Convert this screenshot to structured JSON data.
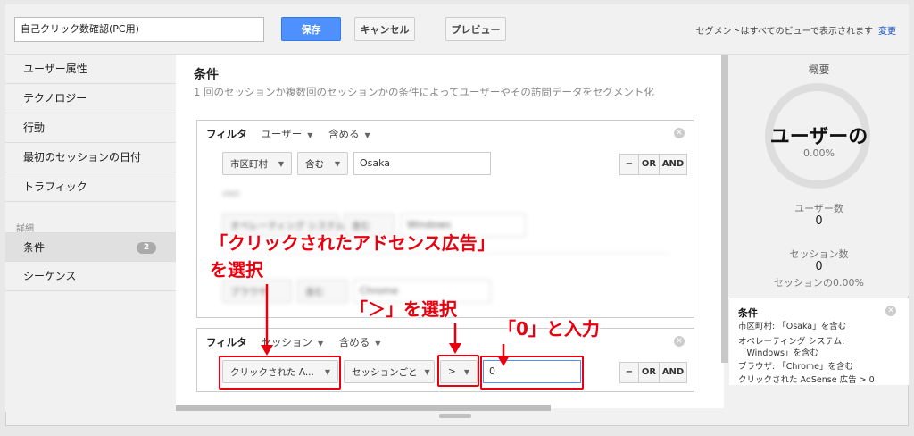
{
  "topbar": {
    "segment_name": "自己クリック数確認(PC用)",
    "save_label": "保存",
    "cancel_label": "キャンセル",
    "preview_label": "プレビュー",
    "segment_note": "セグメントはすべてのビューで表示されます",
    "change_link": "変更"
  },
  "sidebar": {
    "items": [
      "ユーザー属性",
      "テクノロジー",
      "行動",
      "最初のセッションの日付",
      "トラフィック"
    ],
    "section_label": "詳細",
    "advanced_items": [
      {
        "label": "条件",
        "badge": "2"
      },
      {
        "label": "シーケンス"
      }
    ]
  },
  "main": {
    "title": "条件",
    "description": "1 回のセッションか複数回のセッションかの条件によってユーザーやその訪問データをセグメント化"
  },
  "filter1": {
    "label": "フィルタ",
    "scope": "ユーザー",
    "mode": "含める",
    "rows": [
      {
        "dimension": "市区町村",
        "operator": "含む",
        "value": "Osaka"
      }
    ],
    "and_text": "AND",
    "blurred_rows": [
      {
        "dimension": "オペレーティング システム",
        "operator": "含む",
        "value": "Windows"
      },
      {
        "dimension": "ブラウザ",
        "operator": "含む",
        "value": "Chrome"
      }
    ]
  },
  "filter2": {
    "label": "フィルタ",
    "scope": "セッション",
    "mode": "含める",
    "dimension": "クリックされた A...",
    "per": "セッションごと",
    "operator": ">",
    "value": "0"
  },
  "row_buttons": {
    "minus": "−",
    "or": "OR",
    "and": "AND"
  },
  "summary": {
    "title": "概要",
    "gauge_label": "ユーザーの",
    "gauge_pct": "0.00%",
    "users_label": "ユーザー数",
    "users_value": "0",
    "sessions_label": "セッション数",
    "sessions_value": "0",
    "sessions_pct": "セッションの0.00%"
  },
  "conditions_summary": {
    "title": "条件",
    "lines": [
      "市区町村: 「Osaka」を含む",
      "オペレーティング システム:",
      "「Windows」を含む",
      "ブラウザ: 「Chrome」を含む",
      "クリックされた AdSense 広告 > 0"
    ]
  },
  "annotations": {
    "select_ad_line1": "「クリックされたアドセンス広告」",
    "select_ad_line2": "を選択",
    "select_gt": "「＞」を選択",
    "enter_zero": "「0」と入力",
    "color": "#e8000f"
  },
  "colors": {
    "save_button": "#4d90fe",
    "link": "#1a55c9"
  }
}
